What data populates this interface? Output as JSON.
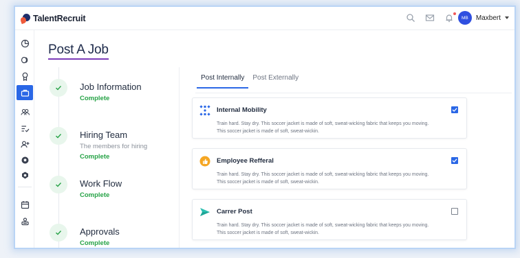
{
  "app": {
    "name": "TalentRecruit"
  },
  "header": {
    "user_initials": "MB",
    "user_name": "Maxbert",
    "icons": [
      "search-icon",
      "mail-icon",
      "bell-icon"
    ]
  },
  "sidebar": {
    "items": [
      {
        "icon": "pie-chart-icon",
        "active": false
      },
      {
        "icon": "coins-icon",
        "active": false
      },
      {
        "icon": "award-icon",
        "active": false
      },
      {
        "icon": "briefcase-icon",
        "active": true
      },
      {
        "icon": "users-icon",
        "active": false
      },
      {
        "icon": "list-check-icon",
        "active": false
      },
      {
        "icon": "user-plus-icon",
        "active": false
      },
      {
        "icon": "soccer-ball-icon",
        "active": false
      },
      {
        "icon": "badge-icon",
        "active": false
      },
      {
        "icon": "calendar-icon",
        "active": false
      },
      {
        "icon": "id-card-icon",
        "active": false
      }
    ]
  },
  "page": {
    "title": "Post A Job"
  },
  "steps": [
    {
      "title": "Job Information",
      "subtitle": "",
      "status": "Complete"
    },
    {
      "title": "Hiring Team",
      "subtitle": "The members for hiring",
      "status": "Complete"
    },
    {
      "title": "Work Flow",
      "subtitle": "",
      "status": "Complete"
    },
    {
      "title": "Approvals",
      "subtitle": "",
      "status": "Complete"
    }
  ],
  "tabs": [
    {
      "label": "Post Internally",
      "active": true
    },
    {
      "label": "Post Externally",
      "active": false
    }
  ],
  "options": [
    {
      "title": "Internal Mobility",
      "description": "Train hard. Stay dry. This soccer jacket is made of soft, sweat-wicking fabric that keeps you moving. This soccer jacket is made of soft, sweat-wickin.",
      "checked": true,
      "icon": "mobility-icon"
    },
    {
      "title": "Employee Refferal",
      "description": "Train hard. Stay dry. This soccer jacket is made of soft, sweat-wicking fabric that keeps you moving. This soccer jacket is made of soft, sweat-wickin.",
      "checked": true,
      "icon": "thumbs-up-icon"
    },
    {
      "title": "Carrer Post",
      "description": "Train hard. Stay dry. This soccer jacket is made of soft, sweat-wicking fabric that keeps you moving. This soccer jacket is made of soft, sweat-wickin.",
      "checked": false,
      "icon": "send-icon"
    }
  ],
  "colors": {
    "accent": "#2a67e6",
    "complete": "#27a347",
    "title_underline": "#7b3bb8",
    "brand_orange": "#ef5b3b",
    "brand_navy": "#1f2f6b"
  }
}
